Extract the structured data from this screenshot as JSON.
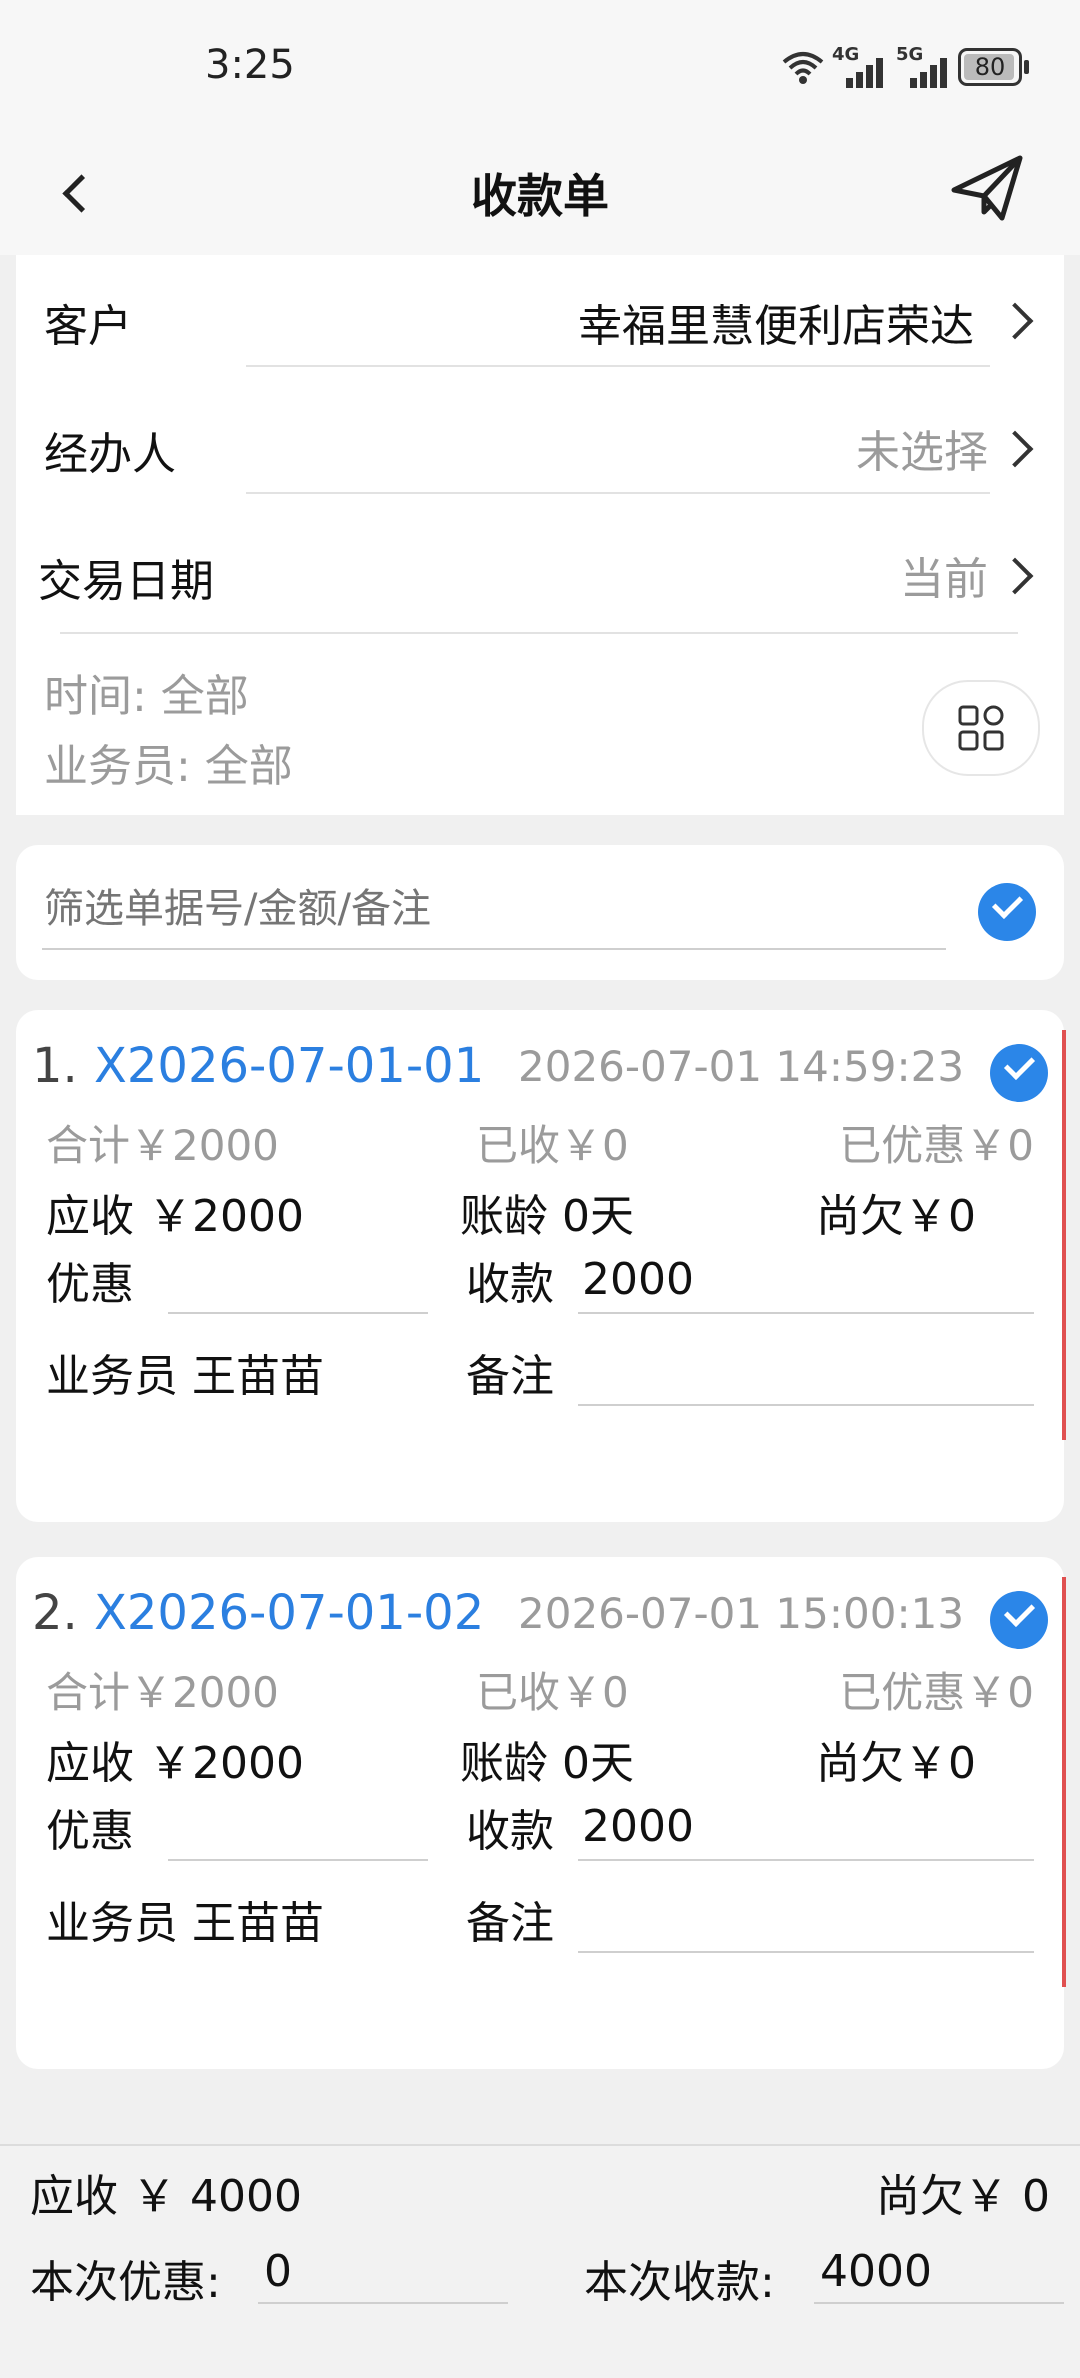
{
  "status": {
    "time": "3:25",
    "net1": "4G",
    "net2": "5G",
    "battery": "80"
  },
  "nav": {
    "title": "收款单"
  },
  "form": {
    "customer_label": "客户",
    "customer_value": "幸福里慧便利店荣达",
    "handler_label": "经办人",
    "handler_value": "未选择",
    "date_label": "交易日期",
    "date_value": "当前",
    "filter_time": "时间:  全部",
    "filter_staff": "业务员:  全部"
  },
  "search": {
    "placeholder": "筛选单据号/金额/备注"
  },
  "orders": [
    {
      "index": "1.",
      "id": "X2026-07-01-01",
      "datetime": "2026-07-01 14:59:23",
      "total": "合计￥2000",
      "received": "已收￥0",
      "discounted": "已优惠￥0",
      "due": "应收 ￥2000",
      "age": "账龄 0天",
      "owed": "尚欠￥0",
      "discount_label": "优惠",
      "discount_value": "",
      "payment_label": "收款",
      "payment_value": "2000",
      "staff": "业务员 王苗苗",
      "note_label": "备注",
      "note_value": ""
    },
    {
      "index": "2.",
      "id": "X2026-07-01-02",
      "datetime": "2026-07-01 15:00:13",
      "total": "合计￥2000",
      "received": "已收￥0",
      "discounted": "已优惠￥0",
      "due": "应收 ￥2000",
      "age": "账龄 0天",
      "owed": "尚欠￥0",
      "discount_label": "优惠",
      "discount_value": "",
      "payment_label": "收款",
      "payment_value": "2000",
      "staff": "业务员 王苗苗",
      "note_label": "备注",
      "note_value": ""
    }
  ],
  "footer": {
    "due": "应收 ￥ 4000",
    "owed": "尚欠￥ 0",
    "discount_label": "本次优惠:",
    "discount_value": "0",
    "payment_label": "本次收款:",
    "payment_value": "4000"
  },
  "colors": {
    "accent": "#2b86e8",
    "link": "#2b7fe0"
  }
}
